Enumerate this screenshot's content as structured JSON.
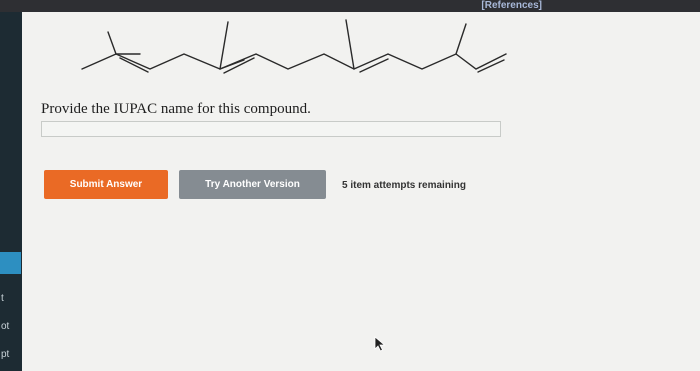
{
  "header": {
    "references_label": "[References]"
  },
  "sidebar": {
    "tabs": [
      {
        "label": ""
      },
      {
        "label": "t"
      },
      {
        "label": "ot"
      },
      {
        "label": "pt"
      }
    ]
  },
  "question": {
    "prompt": "Provide the IUPAC name for this compound."
  },
  "answer": {
    "value": "",
    "placeholder": ""
  },
  "buttons": {
    "submit_label": "Submit Answer",
    "try_label": "Try Another Version"
  },
  "attempts_text": "5 item attempts remaining",
  "colors": {
    "submit": "#ea6a25",
    "try": "#858c92",
    "sidebar": "#1d2b33",
    "sidebar_active": "#2d8fc1"
  },
  "icons": {
    "pointer": "cursor-arrow-icon"
  }
}
